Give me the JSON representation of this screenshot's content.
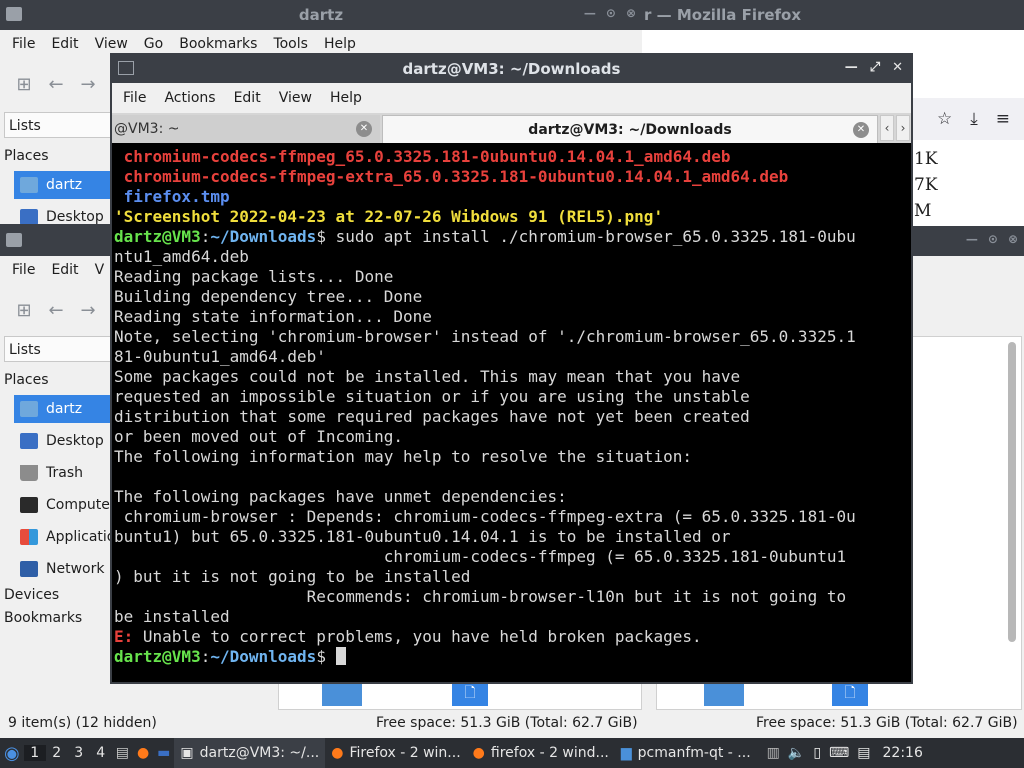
{
  "top_fm": {
    "title": "dartz",
    "menu": [
      "File",
      "Edit",
      "View",
      "Go",
      "Bookmarks",
      "Tools",
      "Help"
    ],
    "lists_label": "Lists",
    "places_label": "Places",
    "places": [
      "dartz",
      "Desktop"
    ]
  },
  "firefox_bg": {
    "title": "r — Mozilla Firefox",
    "sizes": [
      "1K",
      "7K",
      "M"
    ]
  },
  "left_fm": {
    "menu": [
      "File",
      "Edit",
      "V"
    ],
    "lists_label": "Lists",
    "places_label": "Places",
    "places": [
      "dartz",
      "Desktop",
      "Trash",
      "Compute",
      "Applicatio",
      "Network"
    ],
    "devices_label": "Devices",
    "bookmarks_label": "Bookmarks",
    "status_items": "9 item(s) (12 hidden)",
    "status_free": "Free space: 51.3 GiB (Total: 62.7 GiB)"
  },
  "right_fm": {
    "status_free": "Free space: 51.3 GiB (Total: 62.7 GiB)"
  },
  "terminal": {
    "title": "dartz@VM3: ~/Downloads",
    "menu": [
      "File",
      "Actions",
      "Edit",
      "View",
      "Help"
    ],
    "tab_inactive": "@VM3: ~",
    "tab_active": "dartz@VM3: ~/Downloads",
    "lines": [
      " chromium-codecs-ffmpeg_65.0.3325.181-0ubuntu0.14.04.1_amd64.deb",
      " chromium-codecs-ffmpeg-extra_65.0.3325.181-0ubuntu0.14.04.1_amd64.deb",
      " firefox.tmp",
      "'Screenshot 2022-04-23 at 22-07-26 Wibdows 91 (REL5).png'",
      "PROMPT:sudo apt install ./chromium-browser_65.0.3325.181-0ubu",
      "ntu1_amd64.deb",
      "Reading package lists... Done",
      "Building dependency tree... Done",
      "Reading state information... Done",
      "Note, selecting 'chromium-browser' instead of './chromium-browser_65.0.3325.1",
      "81-0ubuntu1_amd64.deb'",
      "Some packages could not be installed. This may mean that you have",
      "requested an impossible situation or if you are using the unstable",
      "distribution that some required packages have not yet been created",
      "or been moved out of Incoming.",
      "The following information may help to resolve the situation:",
      "",
      "The following packages have unmet dependencies:",
      " chromium-browser : Depends: chromium-codecs-ffmpeg-extra (= 65.0.3325.181-0u",
      "buntu1) but 65.0.3325.181-0ubuntu0.14.04.1 is to be installed or",
      "                            chromium-codecs-ffmpeg (= 65.0.3325.181-0ubuntu1",
      ") but it is not going to be installed",
      "                    Recommends: chromium-browser-l10n but it is not going to",
      "be installed",
      "E: Unable to correct problems, you have held broken packages.",
      "PROMPT:"
    ],
    "prompt_user": "dartz@VM3",
    "prompt_sep": ":",
    "prompt_path": "~/Downloads",
    "prompt_sign": "$ ",
    "error_prefix": "E:"
  },
  "taskbar": {
    "workspaces": [
      "1",
      "2",
      "3",
      "4"
    ],
    "tasks": [
      "dartz@VM3: ~/...",
      "Firefox - 2 win...",
      "firefox - 2 wind...",
      "pcmanfm-qt - ..."
    ],
    "clock": "22:16"
  }
}
